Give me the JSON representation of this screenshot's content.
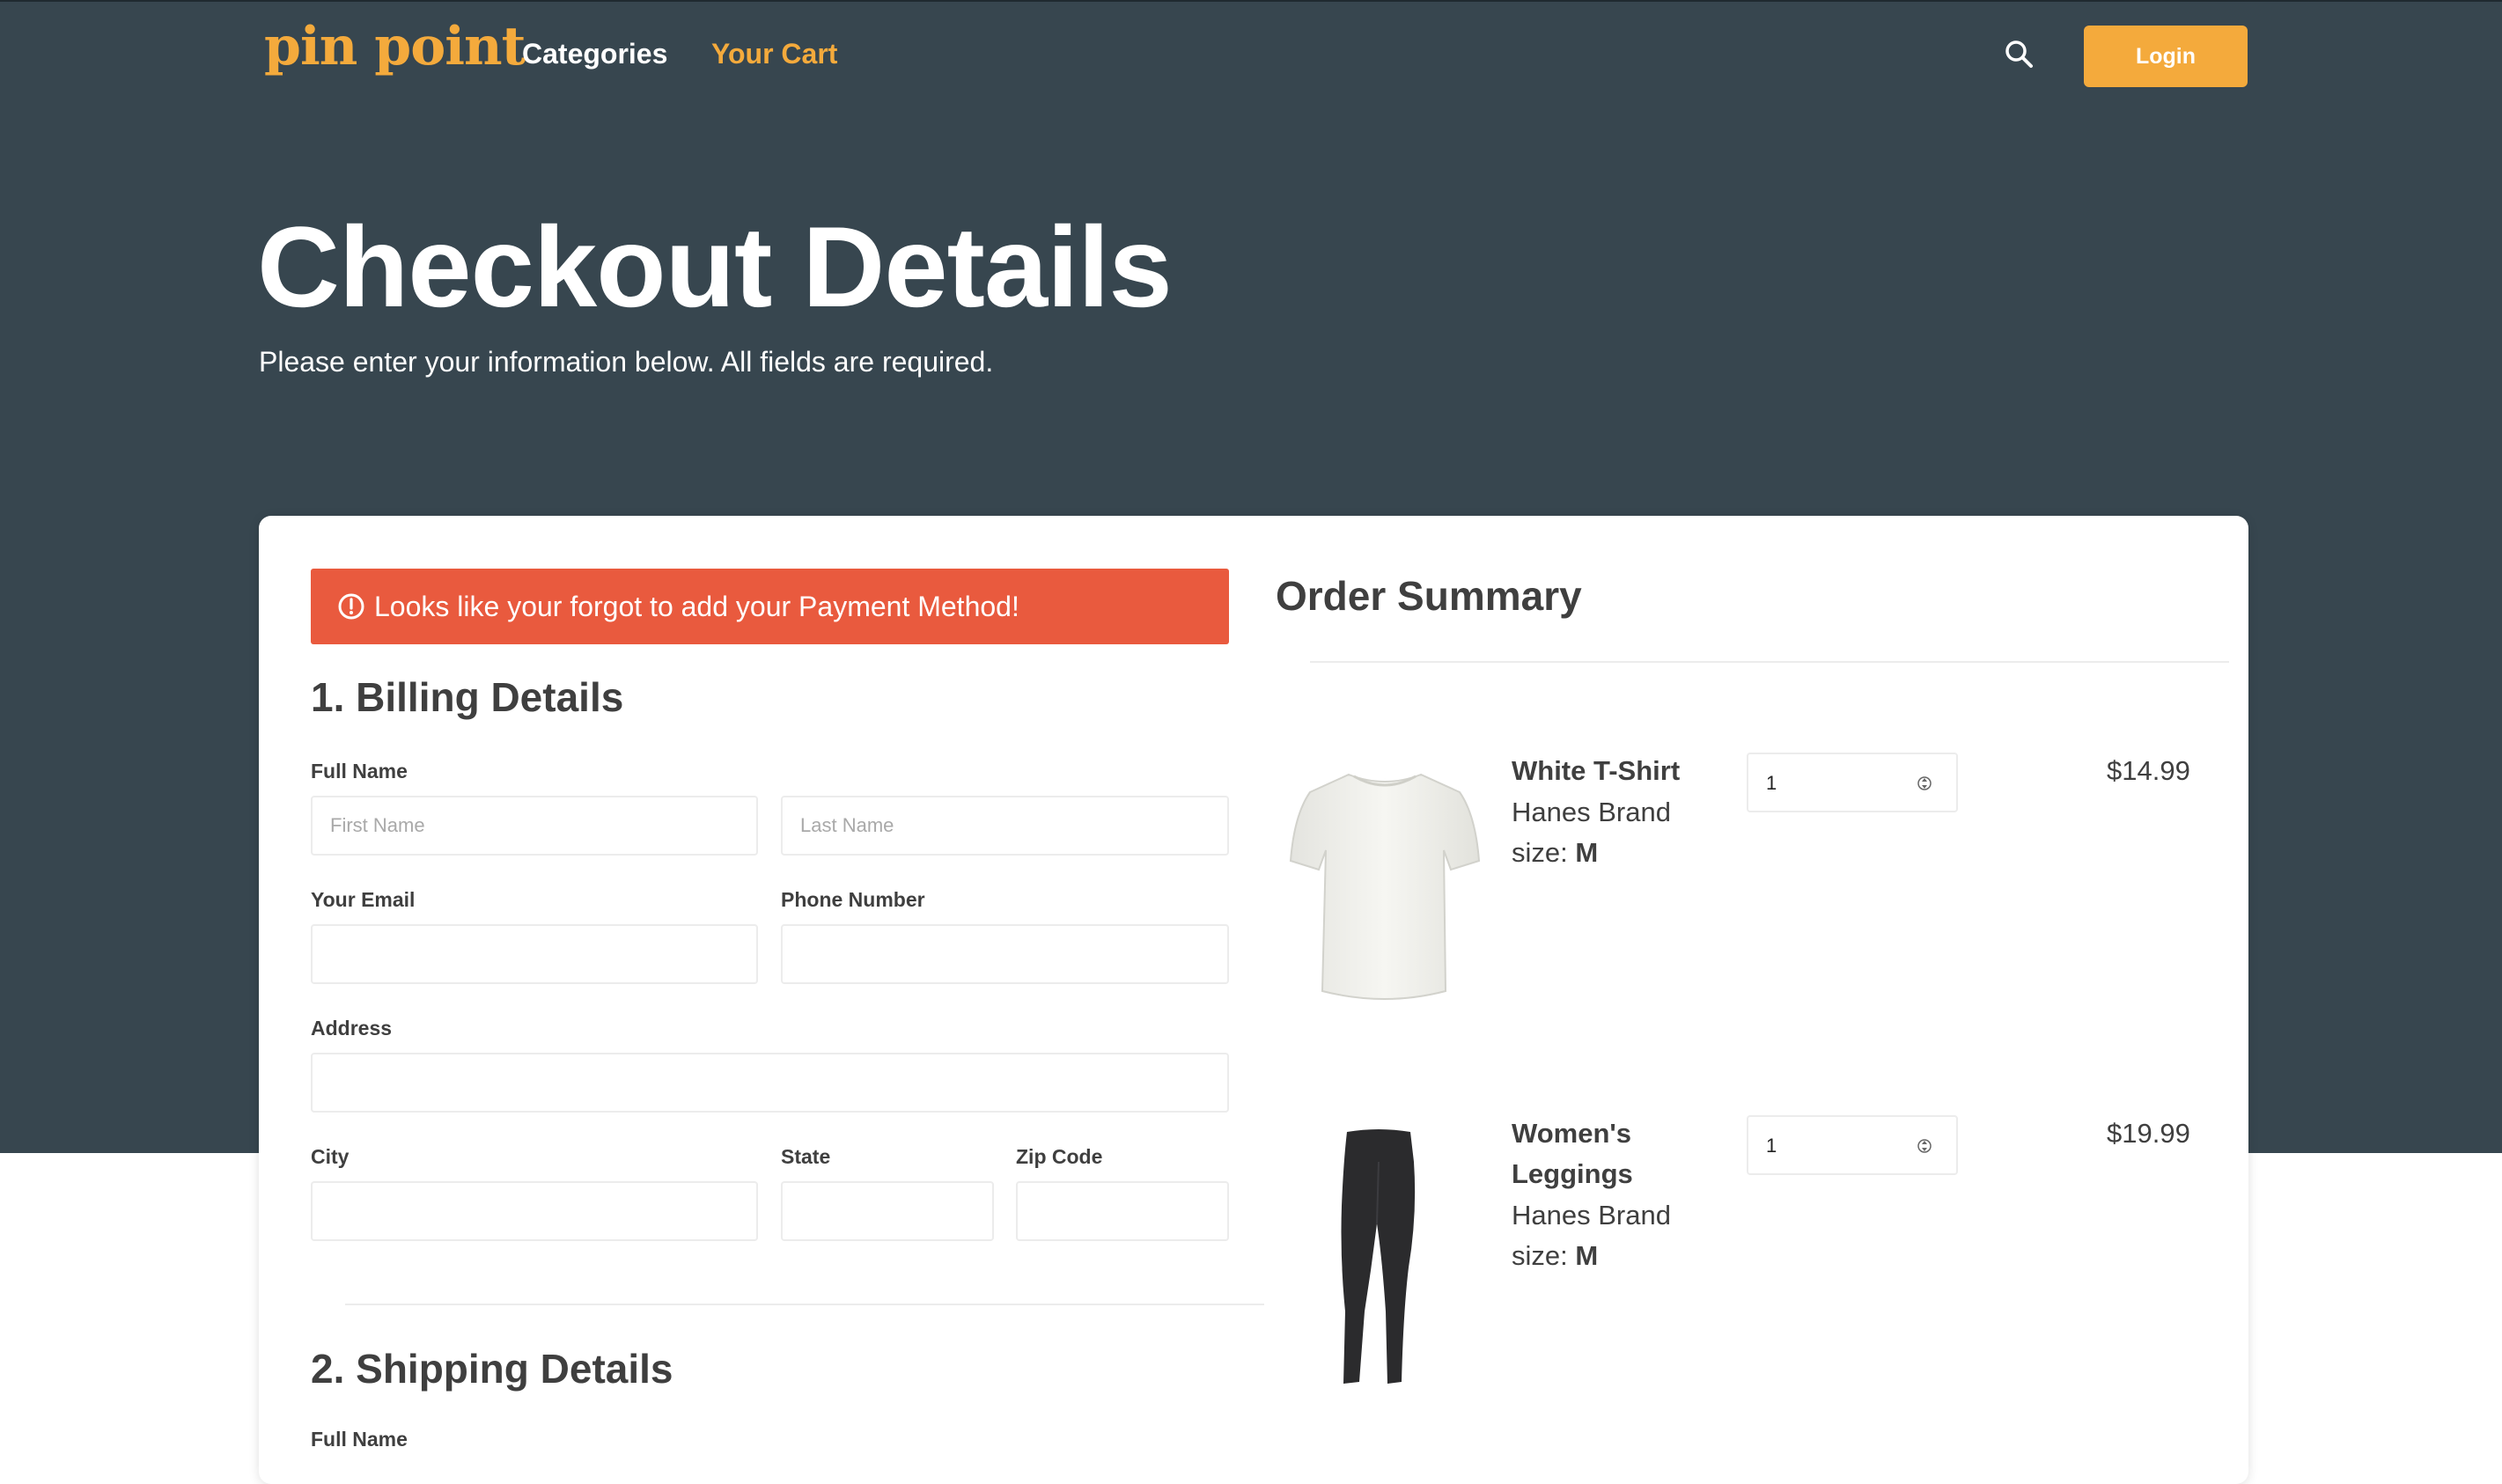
{
  "brand": {
    "logo_text": "pin point"
  },
  "nav": {
    "categories": "Categories",
    "cart": "Your Cart",
    "login": "Login"
  },
  "hero": {
    "title": "Checkout Details",
    "subtitle": "Please enter your information below. All fields are required."
  },
  "alert": {
    "message": "Looks like your forgot to add your Payment Method!"
  },
  "billing": {
    "title": "1. Billing Details",
    "full_name_label": "Full Name",
    "first_name_placeholder": "First Name",
    "last_name_placeholder": "Last Name",
    "email_label": "Your Email",
    "phone_label": "Phone Number",
    "address_label": "Address",
    "city_label": "City",
    "state_label": "State",
    "zip_label": "Zip Code"
  },
  "shipping": {
    "title": "2. Shipping Details",
    "full_name_label": "Full Name"
  },
  "summary": {
    "title": "Order Summary",
    "items": [
      {
        "name": "White T-Shirt",
        "brand": "Hanes Brand",
        "size_label": "size:",
        "size": "M",
        "qty": "1",
        "price": "$14.99"
      },
      {
        "name": "Women's Leggings",
        "brand": "Hanes Brand",
        "size_label": "size:",
        "size": "M",
        "qty": "1",
        "price": "$19.99"
      }
    ]
  },
  "colors": {
    "accent": "#f4aa3c",
    "hero_bg": "#37464f",
    "alert": "#e95a3e",
    "text": "#3f3f3f"
  },
  "icons": {
    "search": "search-icon",
    "alert": "alert-circle-icon",
    "spinner": "spinner-arrows-icon"
  }
}
